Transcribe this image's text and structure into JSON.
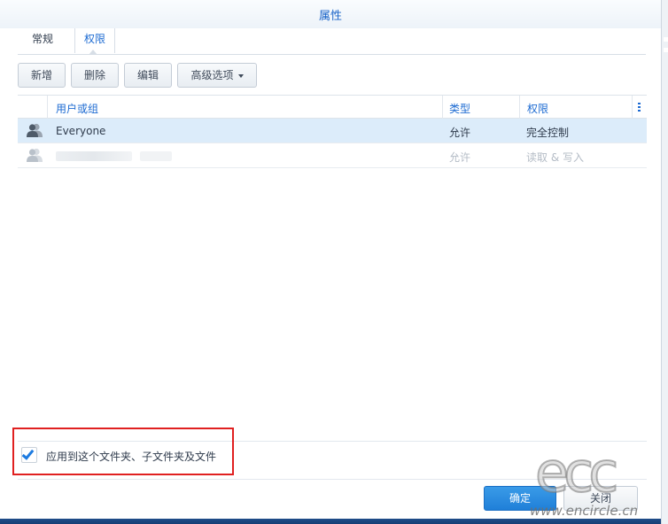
{
  "window": {
    "title": "属性"
  },
  "tabs": [
    {
      "label": "常规",
      "active": false
    },
    {
      "label": "权限",
      "active": true
    }
  ],
  "toolbar": {
    "add_label": "新增",
    "delete_label": "删除",
    "edit_label": "编辑",
    "advanced_label": "高级选项"
  },
  "grid": {
    "columns": [
      "用户或组",
      "类型",
      "权限"
    ],
    "rows": [
      {
        "name": "Everyone",
        "type": "允许",
        "permission": "完全控制",
        "selected": true,
        "icon": "group-icon"
      },
      {
        "name": "",
        "type": "允许",
        "permission": "读取 & 写入",
        "selected": false,
        "icon": "group-icon",
        "name_obscured": true
      }
    ]
  },
  "apply_option": {
    "label": "应用到这个文件夹、子文件夹及文件",
    "checked": true
  },
  "footer": {
    "ok_label": "确定",
    "close_label": "关闭"
  },
  "watermark": {
    "logo": "ecc",
    "url": "www.encircle.cn"
  },
  "colors": {
    "accent": "#1d6bd2",
    "selected_row": "#dcecfa",
    "primary_button": "#2a8ee0",
    "highlight_border": "#e02020",
    "taskbar": "#1f4c8a"
  }
}
